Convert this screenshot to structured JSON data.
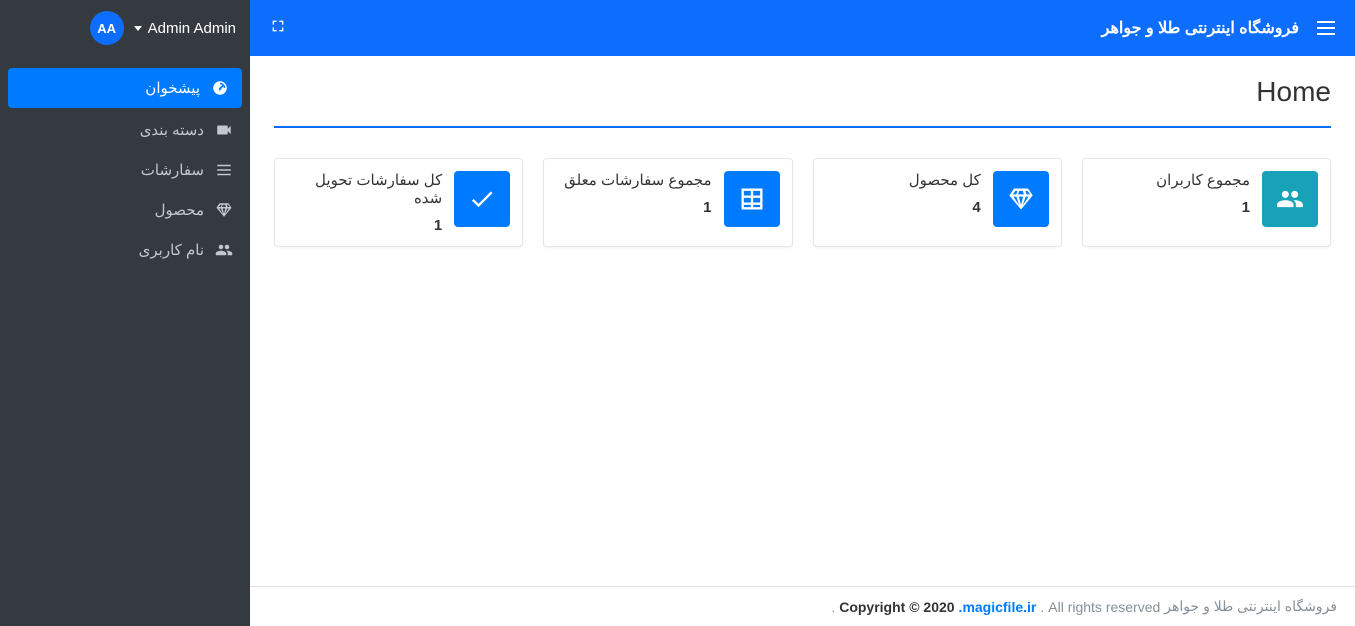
{
  "header": {
    "brand": "فروشگاه اینترنتی طلا و جواهر",
    "user_name": "Admin Admin",
    "user_initials": "AA"
  },
  "sidebar": {
    "items": [
      {
        "label": "پیشخوان",
        "icon": "dashboard",
        "active": true
      },
      {
        "label": "دسته بندی",
        "icon": "category",
        "active": false
      },
      {
        "label": "سفارشات",
        "icon": "orders",
        "active": false
      },
      {
        "label": "محصول",
        "icon": "product",
        "active": false
      },
      {
        "label": "نام کاربری",
        "icon": "users",
        "active": false
      }
    ]
  },
  "page": {
    "title": "Home"
  },
  "cards": [
    {
      "label": "مجموع کاربران",
      "value": "1",
      "icon": "users",
      "color": "teal"
    },
    {
      "label": "کل محصول",
      "value": "4",
      "icon": "diamond",
      "color": "blue"
    },
    {
      "label": "مجموع سفارشات معلق",
      "value": "1",
      "icon": "table",
      "color": "blue"
    },
    {
      "label": "کل سفارشات تحویل شده",
      "value": "1",
      "icon": "check",
      "color": "blue"
    }
  ],
  "footer": {
    "brand": "فروشگاه اینترنتی طلا و جواهر",
    "rights": "All rights reserved",
    "copyright": "Copyright © 2020",
    "link": "magicfile.ir."
  }
}
